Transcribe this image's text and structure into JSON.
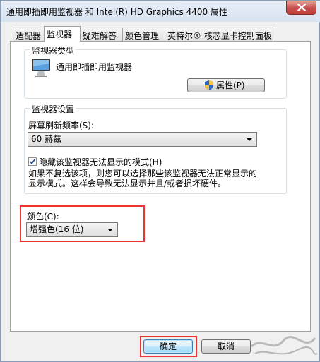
{
  "window": {
    "title": "通用即插即用监视器 和 Intel(R) HD Graphics 4400 属性"
  },
  "tabs": [
    {
      "label": "适配器"
    },
    {
      "label": "监视器"
    },
    {
      "label": "疑难解答"
    },
    {
      "label": "颜色管理"
    },
    {
      "label": "英特尔® 核芯显卡控制面板"
    }
  ],
  "monitor_type": {
    "group_label": "监视器类型",
    "monitor_name": "通用即插即用监视器",
    "properties_button": "属性(P)"
  },
  "monitor_settings": {
    "group_label": "监视器设置",
    "refresh_label": "屏幕刷新频率(S):",
    "refresh_value": "60 赫兹",
    "hide_modes_label": "隐藏该监视器无法显示的模式(H)",
    "hide_modes_checked": true,
    "description_line1": "如果不复选该项，则您可以选择那些该监视器无法正常显示的",
    "description_line2": "显示模式。这样会导致无法显示并且/或者损坏硬件。"
  },
  "color": {
    "label": "颜色(C):",
    "value": "增强色(16 位)"
  },
  "footer": {
    "ok_button": "确定",
    "cancel_button": "取消"
  }
}
